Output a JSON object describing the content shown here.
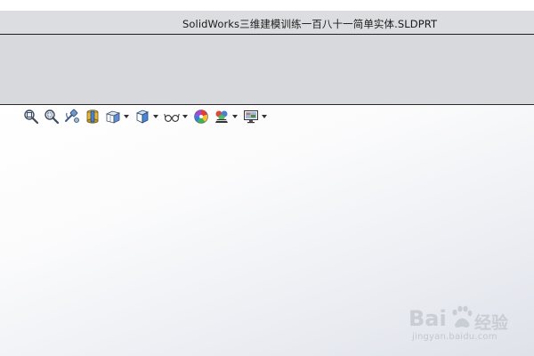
{
  "window": {
    "title": "SolidWorks三维建模训练一百八十一简单实体.SLDPRT"
  },
  "heads_up_toolbar": {
    "items": [
      {
        "icon": "zoom-to-fit-icon",
        "dropdown": false
      },
      {
        "icon": "zoom-to-area-icon",
        "dropdown": false
      },
      {
        "icon": "previous-view-icon",
        "dropdown": false
      },
      {
        "icon": "section-view-icon",
        "dropdown": false
      },
      {
        "icon": "view-orientation-icon",
        "dropdown": true
      },
      {
        "icon": "display-style-icon",
        "dropdown": true
      },
      {
        "icon": "hide-show-items-icon",
        "dropdown": true
      },
      {
        "icon": "edit-appearance-icon",
        "dropdown": false
      },
      {
        "icon": "apply-scene-icon",
        "dropdown": true
      },
      {
        "icon": "view-settings-icon",
        "dropdown": true
      }
    ]
  },
  "watermark": {
    "brand": "Bai",
    "brand_suffix": "经验",
    "url": "jingyan.baidu.com"
  },
  "colors": {
    "titlebar": "#dcdde0",
    "commandmanager": "#d7d9dc",
    "viewport_top": "#ffffff",
    "viewport_bottom": "#dfe2ea",
    "watermark": "#c9cdd4"
  }
}
